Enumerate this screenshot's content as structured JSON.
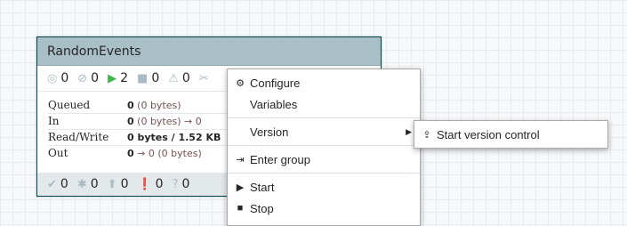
{
  "process_group": {
    "name": "RandomEvents",
    "stats": {
      "transmitting": "0",
      "not_transmitting": "0",
      "running": "2",
      "stopped": "0",
      "invalid": "0"
    },
    "rows": [
      {
        "label": "Queued",
        "value_bold": "0",
        "value_rest": " (0 bytes)"
      },
      {
        "label": "In",
        "value_bold": "0",
        "value_rest": " (0 bytes) → 0"
      },
      {
        "label": "Read/Write",
        "value_bold": "0 bytes / 1.52 KB",
        "value_rest": ""
      },
      {
        "label": "Out",
        "value_bold": "0",
        "value_rest": " → 0 (0 bytes)"
      }
    ],
    "footer": {
      "up_to_date": "0",
      "locally_modified": "0",
      "stale": "0",
      "stale_modified": "0",
      "sync_failure": "0"
    }
  },
  "context_menu": {
    "items": [
      {
        "label": "Configure",
        "icon": "gear-icon"
      },
      {
        "label": "Variables",
        "icon": ""
      },
      {
        "label": "Version",
        "icon": "",
        "submenu": true
      },
      {
        "label": "Enter group",
        "icon": "sign-in-icon"
      },
      {
        "label": "Start",
        "icon": "play-icon"
      },
      {
        "label": "Stop",
        "icon": "stop-icon"
      }
    ]
  },
  "version_submenu": {
    "items": [
      {
        "label": "Start version control",
        "icon": "upload-icon"
      }
    ]
  }
}
